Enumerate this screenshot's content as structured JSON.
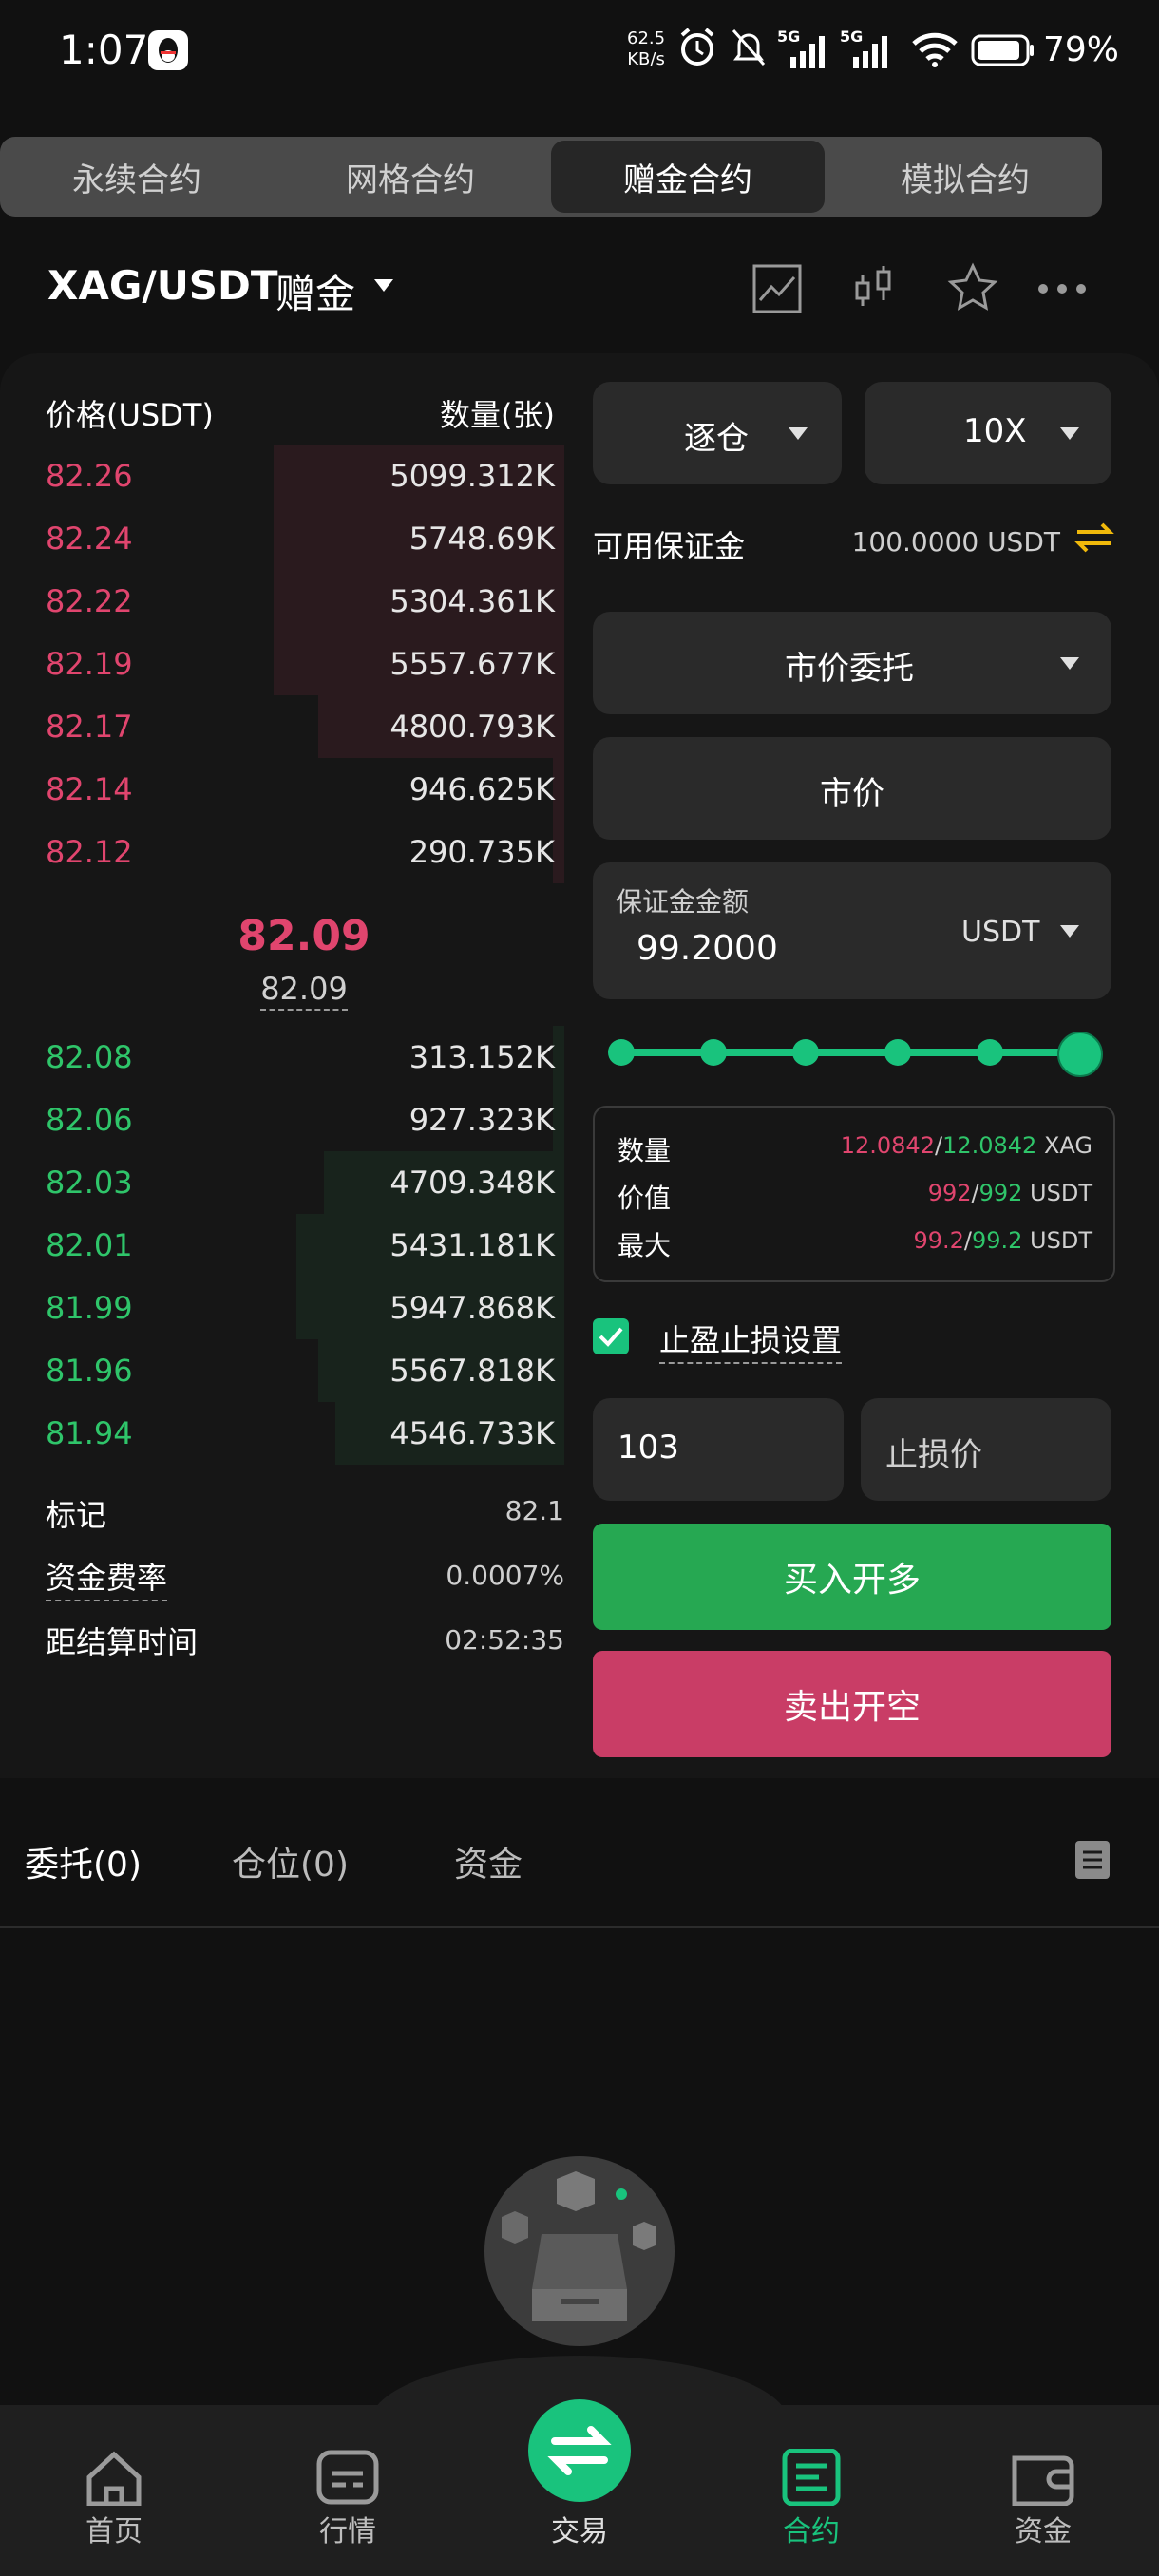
{
  "status_bar": {
    "time": "1:07",
    "net_speed_value": "62.5",
    "net_speed_unit": "KB/s",
    "battery": "79%"
  },
  "tabs": [
    {
      "label": "永续合约",
      "active": false
    },
    {
      "label": "网格合约",
      "active": false
    },
    {
      "label": "赠金合约",
      "active": true
    },
    {
      "label": "模拟合约",
      "active": false
    }
  ],
  "pair": {
    "symbol": "XAG/USDT",
    "tag": "赠金"
  },
  "orderbook": {
    "price_header": "价格(USDT)",
    "qty_header": "数量(张)",
    "asks": [
      {
        "price": "82.26",
        "qty": "5099.312K",
        "depth": 0.52
      },
      {
        "price": "82.24",
        "qty": "5748.69K",
        "depth": 0.52
      },
      {
        "price": "82.22",
        "qty": "5304.361K",
        "depth": 0.52
      },
      {
        "price": "82.19",
        "qty": "5557.677K",
        "depth": 0.52
      },
      {
        "price": "82.17",
        "qty": "4800.793K",
        "depth": 0.44
      },
      {
        "price": "82.14",
        "qty": "946.625K",
        "depth": 0.02
      },
      {
        "price": "82.12",
        "qty": "290.735K",
        "depth": 0.02
      }
    ],
    "last_price": "82.09",
    "index_price": "82.09",
    "bids": [
      {
        "price": "82.08",
        "qty": "313.152K",
        "depth": 0.02
      },
      {
        "price": "82.06",
        "qty": "927.323K",
        "depth": 0.02
      },
      {
        "price": "82.03",
        "qty": "4709.348K",
        "depth": 0.43
      },
      {
        "price": "82.01",
        "qty": "5431.181K",
        "depth": 0.48
      },
      {
        "price": "81.99",
        "qty": "5947.868K",
        "depth": 0.48
      },
      {
        "price": "81.96",
        "qty": "5567.818K",
        "depth": 0.44
      },
      {
        "price": "81.94",
        "qty": "4546.733K",
        "depth": 0.41
      }
    ]
  },
  "stats": [
    {
      "label": "标记",
      "value": "82.1"
    },
    {
      "label": "资金费率",
      "value": "0.0007%"
    },
    {
      "label": "距结算时间",
      "value": "02:52:35"
    }
  ],
  "form": {
    "margin_mode": "逐仓",
    "leverage": "10X",
    "available_label": "可用保证金",
    "available_value": "100.0000 USDT",
    "order_type": "市价委托",
    "price_field": "市价",
    "margin_amount_label": "保证金金额",
    "margin_amount_value": "99.2000",
    "margin_currency": "USDT",
    "slider_fraction": 1.0,
    "info": [
      {
        "label": "数量",
        "a": "12.0842",
        "b": "12.0842",
        "unit": "XAG"
      },
      {
        "label": "价值",
        "a": "992",
        "b": "992",
        "unit": "USDT"
      },
      {
        "label": "最大",
        "a": "99.2",
        "b": "99.2",
        "unit": "USDT"
      }
    ],
    "tpsl_checked": true,
    "tpsl_label": "止盈止损设置",
    "take_profit_value": "103",
    "stop_loss_placeholder": "止损价",
    "buy_label": "买入开多",
    "sell_label": "卖出开空"
  },
  "orders_tabs": [
    "委托(0)",
    "仓位(0)",
    "资金"
  ],
  "nav": [
    {
      "label": "首页",
      "icon": "home-icon"
    },
    {
      "label": "行情",
      "icon": "market-icon"
    },
    {
      "label": "交易",
      "icon": "swap-icon"
    },
    {
      "label": "合约",
      "icon": "contract-icon"
    },
    {
      "label": "资金",
      "icon": "wallet-icon"
    }
  ],
  "colors": {
    "red": "#e0456e",
    "green": "#2fc56a",
    "accent": "#19c37d",
    "buy": "#26a852",
    "sell": "#c93d66"
  }
}
